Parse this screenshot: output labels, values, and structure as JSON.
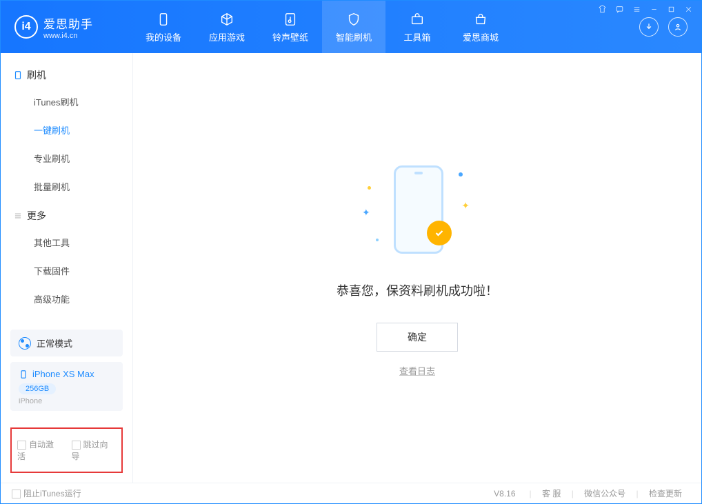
{
  "app": {
    "title": "爱思助手",
    "subtitle": "www.i4.cn"
  },
  "tabs": {
    "device": "我的设备",
    "apps": "应用游戏",
    "ringtones": "铃声壁纸",
    "flash": "智能刷机",
    "toolbox": "工具箱",
    "store": "爱思商城"
  },
  "sidebar": {
    "section_flash": "刷机",
    "items_flash": {
      "itunes": "iTunes刷机",
      "one_key": "一键刷机",
      "pro": "专业刷机",
      "batch": "批量刷机"
    },
    "section_more": "更多",
    "items_more": {
      "other": "其他工具",
      "firmware": "下载固件",
      "advanced": "高级功能"
    },
    "mode": "正常模式",
    "device": {
      "name": "iPhone XS Max",
      "capacity": "256GB",
      "type": "iPhone"
    },
    "check_auto": "自动激活",
    "check_skip": "跳过向导"
  },
  "main": {
    "message": "恭喜您，保资料刷机成功啦！",
    "ok": "确定",
    "view_log": "查看日志"
  },
  "status": {
    "block_itunes": "阻止iTunes运行",
    "version": "V8.16",
    "service": "客 服",
    "wechat": "微信公众号",
    "update": "检查更新"
  }
}
